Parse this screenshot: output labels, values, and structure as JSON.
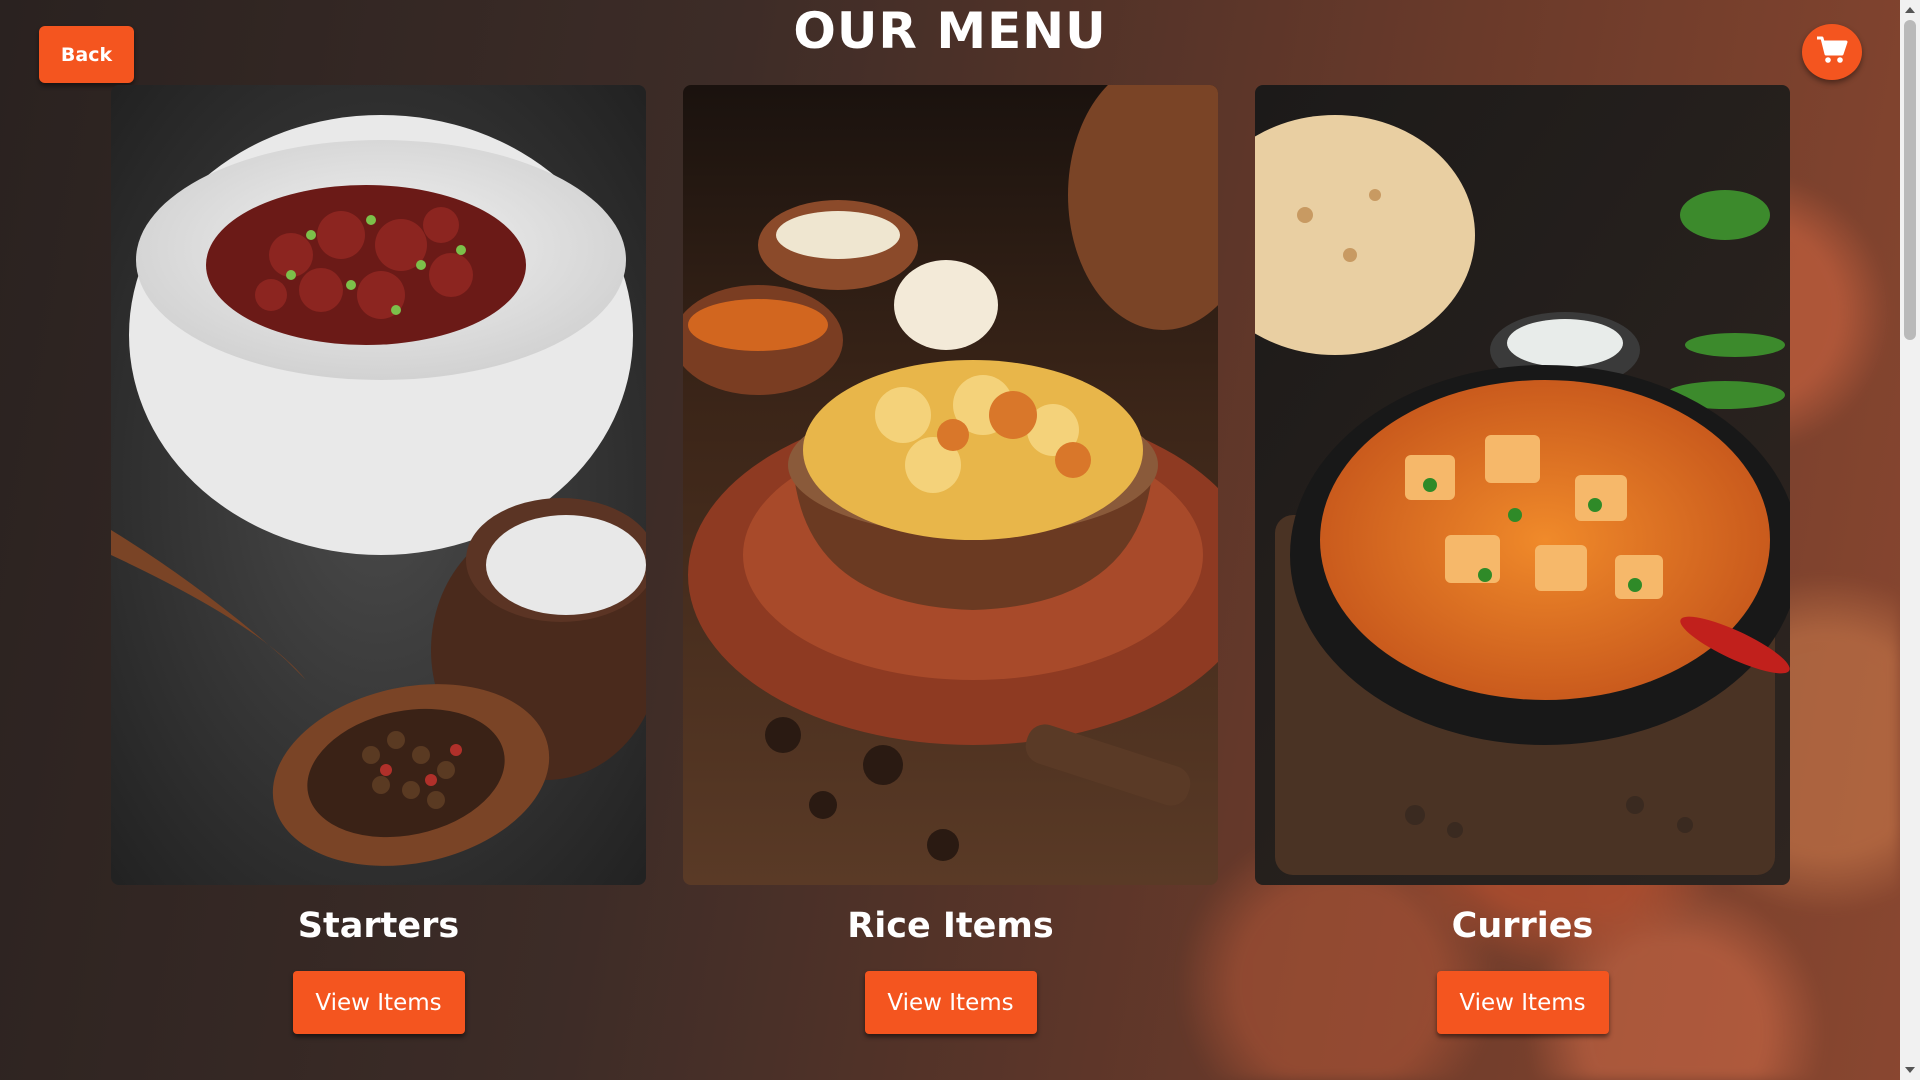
{
  "header": {
    "title": "OUR MENU",
    "back_label": "Back",
    "cart_icon": "shopping-cart-icon"
  },
  "colors": {
    "accent": "#f4551f",
    "background_dark": "#2a2220",
    "background_warm": "#8a4730",
    "text": "#ffffff"
  },
  "categories": [
    {
      "title": "Starters",
      "button_label": "View Items",
      "image": "starters-bowl-photo"
    },
    {
      "title": "Rice Items",
      "button_label": "View Items",
      "image": "biryani-pot-photo"
    },
    {
      "title": "Curries",
      "button_label": "View Items",
      "image": "paneer-curry-photo"
    }
  ]
}
